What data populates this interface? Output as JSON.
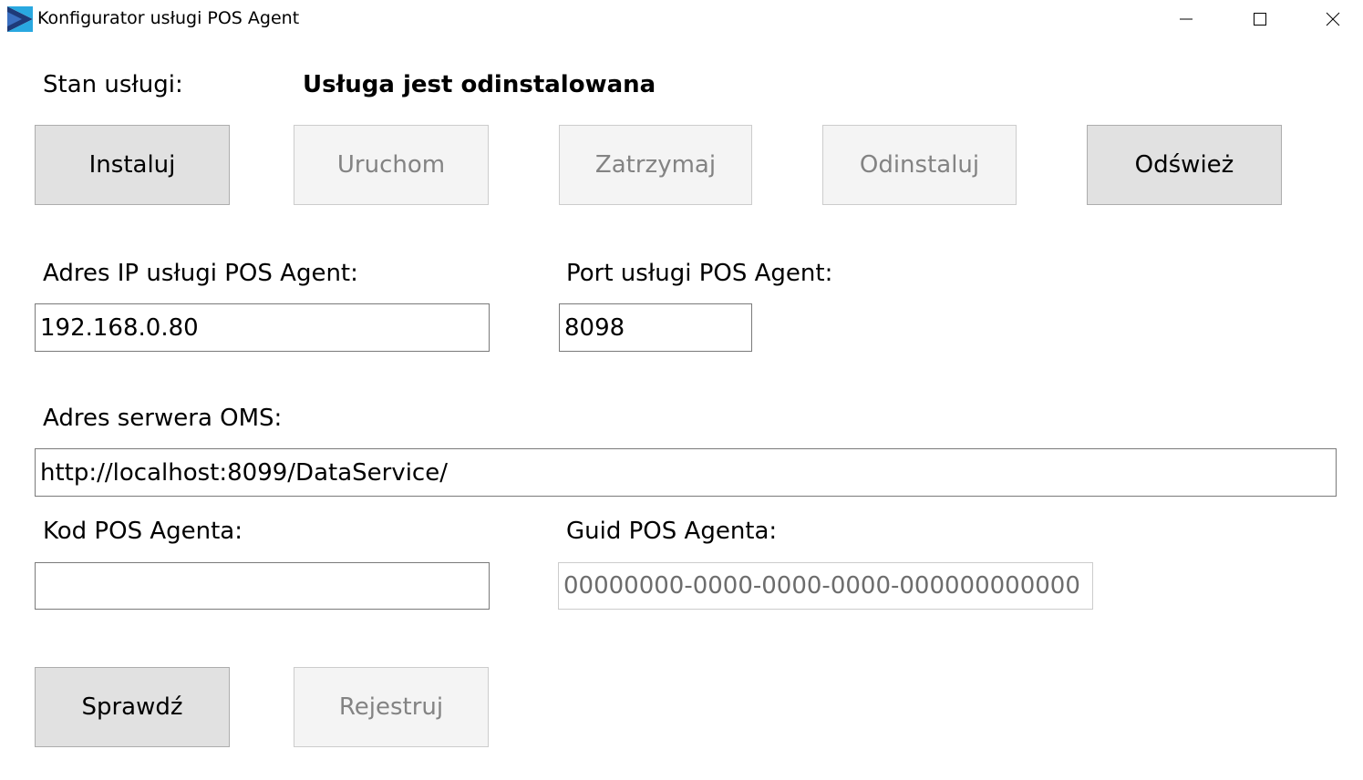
{
  "window": {
    "title": "Konfigurator usługi POS Agent",
    "icon": "app-logo-icon",
    "controls": [
      "minimize-icon",
      "maximize-icon",
      "close-icon"
    ]
  },
  "status": {
    "label": "Stan usługi:",
    "value": "Usługa jest odinstalowana"
  },
  "service_buttons": {
    "install": "Instaluj",
    "start": "Uruchom",
    "stop": "Zatrzymaj",
    "uninstall": "Odinstaluj",
    "refresh": "Odśwież"
  },
  "fields": {
    "ip_label": "Adres IP usługi POS Agent:",
    "ip_value": "192.168.0.80",
    "port_label": "Port usługi POS Agent:",
    "port_value": "8098",
    "oms_label": "Adres serwera OMS:",
    "oms_value": "http://localhost:8099/DataService/",
    "code_label": "Kod POS Agenta:",
    "code_value": "",
    "guid_label": "Guid POS Agenta:",
    "guid_value": "00000000-0000-0000-0000-000000000000"
  },
  "bottom_buttons": {
    "check": "Sprawdź",
    "register": "Rejestruj"
  },
  "colors": {
    "enabled_button_bg": "#e1e1e1",
    "disabled_button_bg": "#f4f4f4",
    "disabled_text": "#838383",
    "logo_dark": "#1e3a78",
    "logo_light": "#29a8e0"
  }
}
